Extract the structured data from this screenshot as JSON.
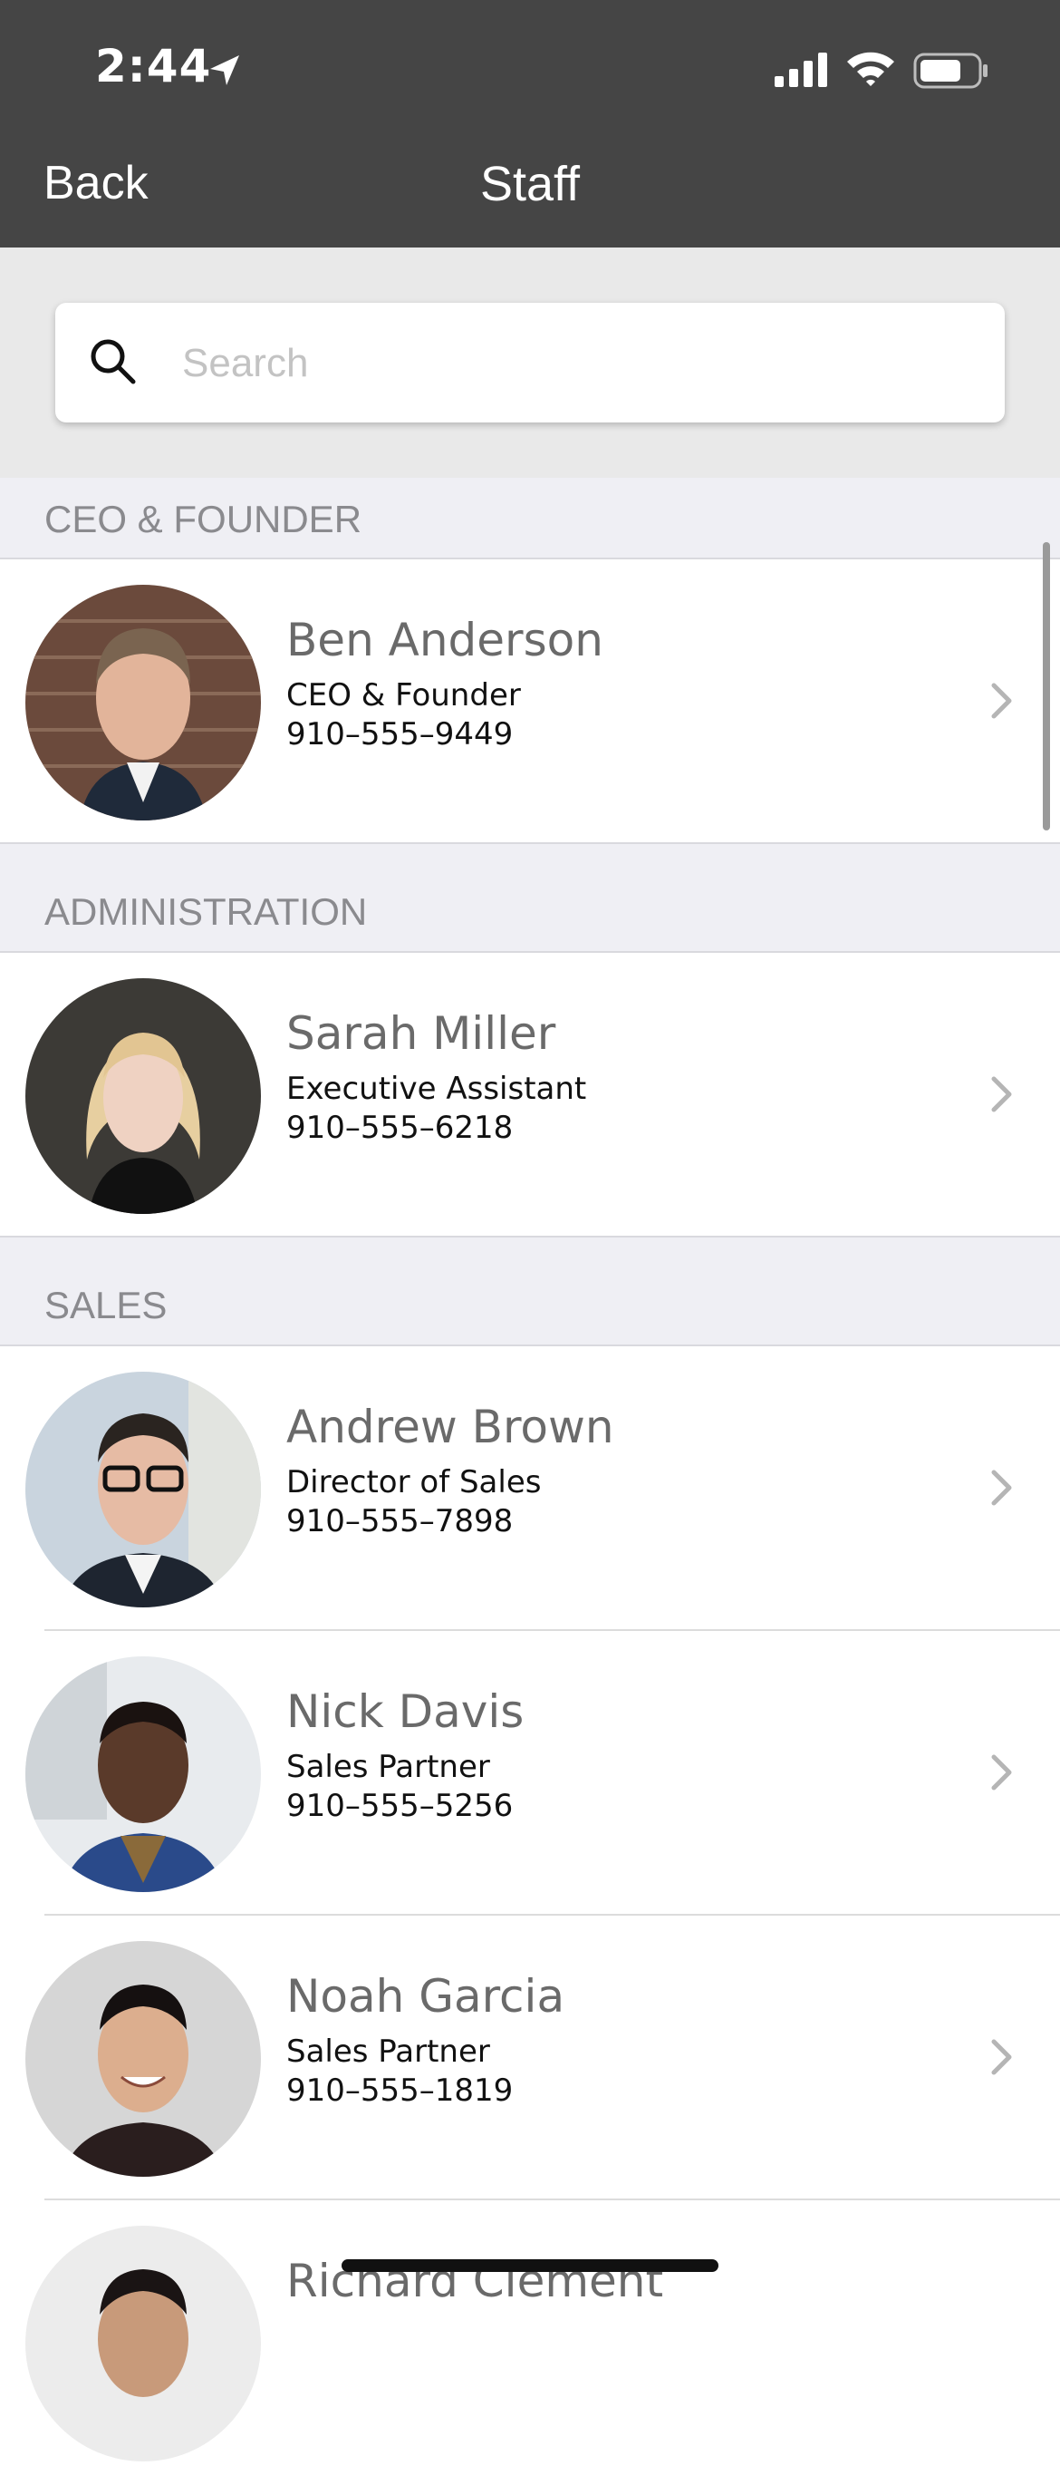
{
  "status_bar": {
    "time": "2:44"
  },
  "nav": {
    "back_label": "Back",
    "title": "Staff"
  },
  "search": {
    "placeholder": "Search"
  },
  "sections": [
    {
      "header": "CEO & FOUNDER",
      "people": [
        {
          "name": "Ben Anderson",
          "role": "CEO & Founder",
          "phone": "910–555–9449"
        }
      ]
    },
    {
      "header": "ADMINISTRATION",
      "people": [
        {
          "name": "Sarah Miller",
          "role": "Executive Assistant",
          "phone": "910–555–6218"
        }
      ]
    },
    {
      "header": "SALES",
      "people": [
        {
          "name": "Andrew Brown",
          "role": "Director of Sales",
          "phone": "910–555–7898"
        },
        {
          "name": "Nick Davis",
          "role": "Sales Partner",
          "phone": "910–555–5256"
        },
        {
          "name": "Noah Garcia",
          "role": "Sales Partner",
          "phone": "910–555–1819"
        },
        {
          "name": "Richard Clement"
        }
      ]
    }
  ],
  "colors": {
    "nav_bg": "#454545",
    "section_bg": "#efeff4",
    "search_bg": "#e9e9e9"
  },
  "icons": [
    "location-arrow-icon",
    "cell-signal-icon",
    "wifi-icon",
    "battery-icon",
    "search-icon",
    "chevron-right-icon"
  ]
}
